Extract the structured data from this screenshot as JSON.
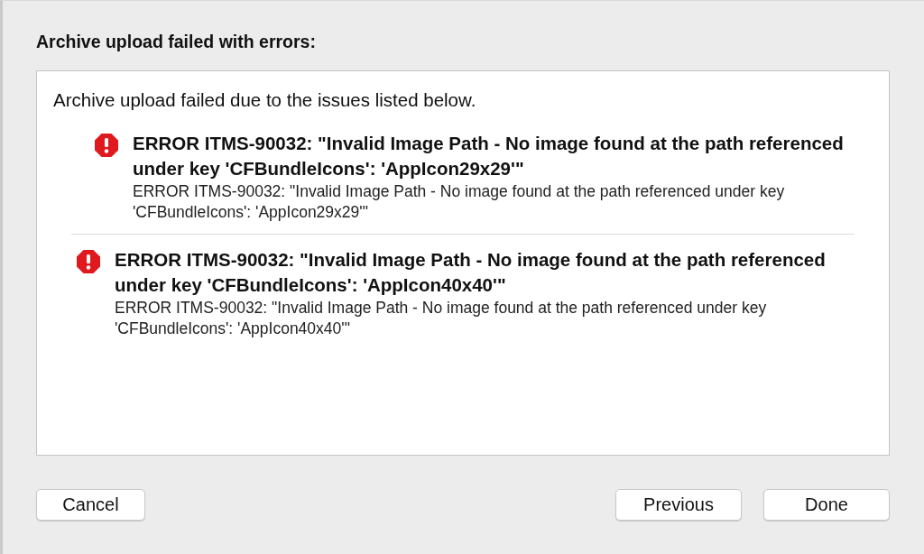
{
  "title": "Archive upload failed with errors:",
  "intro": "Archive upload failed due to the issues listed below.",
  "issues": [
    {
      "kind": "error",
      "summary": "ERROR ITMS-90032: \"Invalid Image Path - No image found at the path referenced under key 'CFBundleIcons': 'AppIcon29x29'\"",
      "detail": "ERROR ITMS-90032: \"Invalid Image Path - No image found at the path referenced under key 'CFBundleIcons': 'AppIcon29x29'\""
    },
    {
      "kind": "error",
      "summary": "ERROR ITMS-90032: \"Invalid Image Path - No image found at the path referenced under key 'CFBundleIcons': 'AppIcon40x40'\"",
      "detail": "ERROR ITMS-90032: \"Invalid Image Path - No image found at the path referenced under key 'CFBundleIcons': 'AppIcon40x40'\""
    }
  ],
  "buttons": {
    "left": [
      "Cancel"
    ],
    "right": [
      "Previous",
      "Done"
    ]
  }
}
